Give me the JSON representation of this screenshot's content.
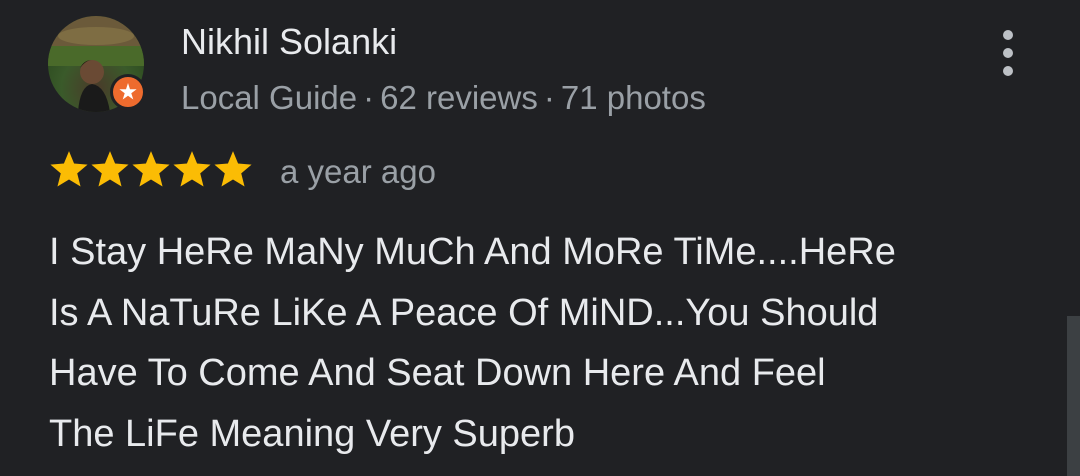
{
  "reviewer": {
    "name": "Nikhil Solanki",
    "level": "Local Guide",
    "reviews": "62 reviews",
    "photos": "71 photos",
    "separator": "·"
  },
  "review": {
    "rating": 5,
    "max_rating": 5,
    "time": "a year ago",
    "lines": [
      "I Stay HeRe MaNy MuCh And MoRe TiMe....HeRe",
      "Is A NaTuRe LiKe A Peace Of MiND...You Should",
      "Have To Come And Seat Down Here And Feel",
      "The LiFe Meaning Very Superb"
    ]
  },
  "colors": {
    "background": "#202124",
    "star": "#fbbc04",
    "badge": "#ee6b2e",
    "primary_text": "#e8eaed",
    "secondary_text": "#9aa0a6"
  },
  "icons": {
    "menu": "more-vert-icon",
    "badge": "local-guide-star-icon",
    "star": "star-filled-icon"
  }
}
